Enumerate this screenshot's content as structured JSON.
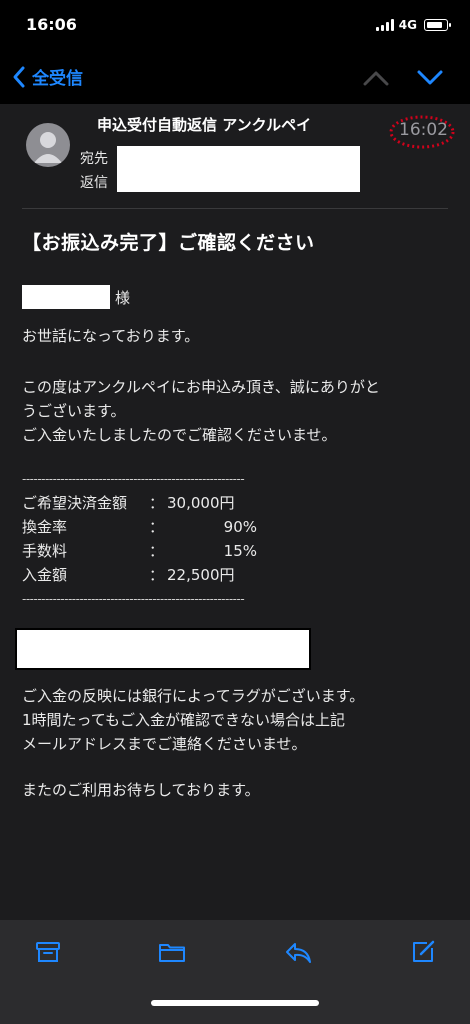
{
  "status_bar": {
    "time": "16:06",
    "network": "4G"
  },
  "nav": {
    "back_label": "全受信"
  },
  "mail": {
    "sender": "申込受付自動返信 アンクルペイ",
    "time": "16:02",
    "to_label": "宛先",
    "reply_label": "返信",
    "subject": "【お振込み完了】ご確認ください",
    "honorific": "様",
    "greeting": "お世話になっております。",
    "paragraph1": "この度はアンクルペイにお申込み頂き、誠にありがと\nうございます。\nご入金いたしましたのでご確認くださいませ。",
    "separator": "----------------------------------------------------------",
    "amounts": [
      {
        "label": "ご希望決済金額",
        "value": "30,000円"
      },
      {
        "label": "換金率",
        "value": "90%"
      },
      {
        "label": "手数料",
        "value": "15%"
      },
      {
        "label": "入金額",
        "value": "22,500円"
      }
    ],
    "paragraph2": "ご入金の反映には銀行によってラグがございます。\n1時間たってもご入金が確認できない場合は上記\nメールアドレスまでご連絡くださいませ。",
    "closing": "またのご利用お待ちしております。"
  },
  "colors": {
    "accent": "#1e87ff",
    "time_circle": "#d0021b",
    "background": "#1c1c1e",
    "toolbar": "#2c2c2e"
  },
  "icons": [
    "back-chevron-icon",
    "chevron-up-icon",
    "chevron-down-icon",
    "archive-icon",
    "folder-icon",
    "reply-icon",
    "compose-icon"
  ]
}
